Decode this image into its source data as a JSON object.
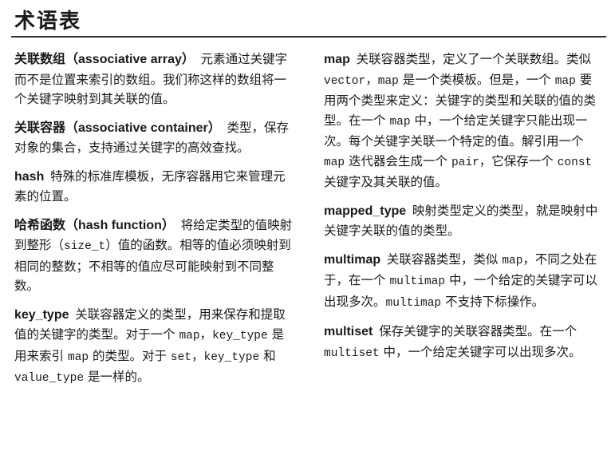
{
  "title": "术语表",
  "left_column": [
    {
      "term": "关联数组（associative array）",
      "parts": [
        {
          "t": "元素通过关键字而不是位置来索引的数组。我们称这样的数组将一个关键字映射到其关联的值。"
        }
      ]
    },
    {
      "term": "关联容器（associative container）",
      "parts": [
        {
          "t": "类型，保存对象的集合，支持通过关键字的高效查找。"
        }
      ]
    },
    {
      "term": "hash",
      "parts": [
        {
          "t": "特殊的标准库模板，无序容器用它来管理元素的位置。"
        }
      ]
    },
    {
      "term": "哈希函数（hash function）",
      "parts": [
        {
          "t": "将给定类型的值映射到整形（"
        },
        {
          "c": "size_t"
        },
        {
          "t": "）值的函数。相等的值必须映射到相同的整数；不相等的值应尽可能映射到不同整数。"
        }
      ]
    },
    {
      "term": "key_type",
      "parts": [
        {
          "t": "关联容器定义的类型，用来保存和提取值的关键字的类型。对于一个 "
        },
        {
          "c": "map"
        },
        {
          "t": "，"
        },
        {
          "c": "key_type"
        },
        {
          "t": " 是用来索引 "
        },
        {
          "c": "map"
        },
        {
          "t": " 的类型。对于 "
        },
        {
          "c": "set"
        },
        {
          "t": "，"
        },
        {
          "c": "key_type"
        },
        {
          "t": " 和 "
        },
        {
          "c": "value_type"
        },
        {
          "t": " 是一样的。"
        }
      ]
    }
  ],
  "right_column": [
    {
      "term": "map",
      "parts": [
        {
          "t": "关联容器类型，定义了一个关联数组。类似 "
        },
        {
          "c": "vector"
        },
        {
          "t": "，"
        },
        {
          "c": "map"
        },
        {
          "t": " 是一个类模板。但是，一个 "
        },
        {
          "c": "map"
        },
        {
          "t": " 要用两个类型来定义：关键字的类型和关联的值的类型。在一个 "
        },
        {
          "c": "map"
        },
        {
          "t": " 中，一个给定关键字只能出现一次。每个关键字关联一个特定的值。解引用一个 "
        },
        {
          "c": "map"
        },
        {
          "t": " 迭代器会生成一个 "
        },
        {
          "c": "pair"
        },
        {
          "t": "，它保存一个 "
        },
        {
          "c": "const"
        },
        {
          "t": " 关键字及其关联的值。"
        }
      ]
    },
    {
      "term": "mapped_type",
      "parts": [
        {
          "t": "映射类型定义的类型，就是映射中关键字关联的值的类型。"
        }
      ]
    },
    {
      "term": "multimap",
      "parts": [
        {
          "t": "关联容器类型，类似 "
        },
        {
          "c": "map"
        },
        {
          "t": "，不同之处在于，在一个 "
        },
        {
          "c": "multimap"
        },
        {
          "t": " 中，一个给定的关键字可以出现多次。"
        },
        {
          "c": "multimap"
        },
        {
          "t": " 不支持下标操作。"
        }
      ]
    },
    {
      "term": "multiset",
      "parts": [
        {
          "t": "保存关键字的关联容器类型。在一个 "
        },
        {
          "c": "multiset"
        },
        {
          "t": " 中，一个给定关键字可以出现多次。"
        }
      ]
    }
  ]
}
